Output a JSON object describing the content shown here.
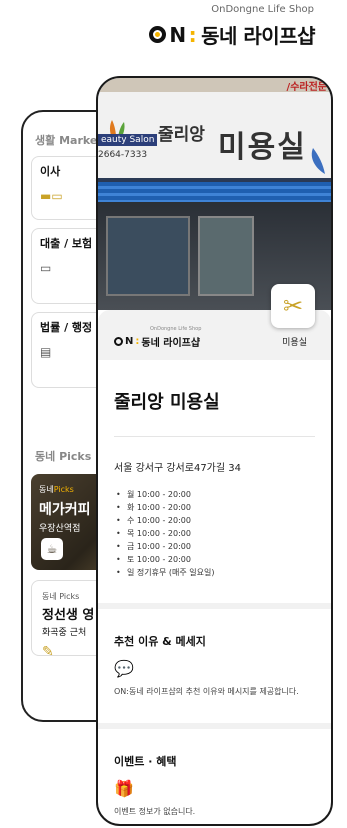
{
  "brand": {
    "subtitle": "OnDongne Life Shop",
    "name_prefix": "ON",
    "name": "동네 라이프샵"
  },
  "back_phone": {
    "section_title": "생활 Market",
    "services": [
      {
        "label": "이사",
        "icon": "truck-icon"
      },
      {
        "label": "대출 / 보험",
        "icon": "card-icon"
      },
      {
        "label": "법률 / 행정",
        "icon": "document-icon"
      }
    ],
    "picks_title": "동네 Picks ™",
    "pick_dark": {
      "kicker_a": "동네",
      "kicker_b": "Picks",
      "title": "메가커피",
      "subtitle": "우장산역점",
      "icon": "cup-icon"
    },
    "pick_light": {
      "kicker": "동네 Picks",
      "title": "정선생 영",
      "subtitle": "화곡중 근처",
      "icon": "pencil-icon"
    }
  },
  "front_phone": {
    "photo": {
      "sign_top": "/수라전문",
      "sign_tag": "eauty Salon",
      "sign_tel": "2664-7333",
      "sign_small": "줄리앙",
      "sign_big": "미용실"
    },
    "category_icon": "scissors-icon",
    "bar": {
      "subtitle": "OnDongne Life Shop",
      "brand_prefix": "ON",
      "brand_name": "동네 라이프샵",
      "category": "미용실"
    },
    "shop_name": "줄리앙 미용실",
    "address": "서울 강서구 강서로47가길 34",
    "hours": [
      "월 10:00 - 20:00",
      "화 10:00 - 20:00",
      "수 10:00 - 20:00",
      "목 10:00 - 20:00",
      "금 10:00 - 20:00",
      "토 10:00 - 20:00",
      "일 정기휴무 (매주 일요일)"
    ],
    "recommend": {
      "title": "추천 이유 & 메세지",
      "icon": "chat-icon",
      "text": "ON:동네 라이프샵의 추천 이유와 메시지를 제공합니다."
    },
    "events": {
      "title": "이벤트 · 혜택",
      "icon": "gift-icon",
      "text": "이벤트 정보가 없습니다."
    }
  },
  "colors": {
    "accent": "#f5b400",
    "icon_gold": "#c9a227",
    "awning_blue": "#1f5fb0"
  }
}
